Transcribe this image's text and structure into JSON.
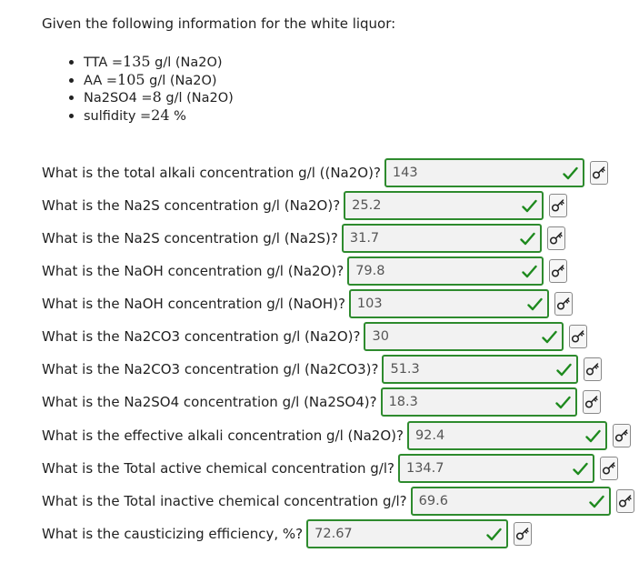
{
  "intro": "Given the following information for the white liquor:",
  "givens": [
    {
      "label": "TTA =",
      "value": "135",
      "unit": " g/l (Na2O)"
    },
    {
      "label": "AA =",
      "value": "105",
      "unit": " g/l (Na2O)"
    },
    {
      "label": "Na2SO4 =",
      "value": "8",
      "unit": " g/l (Na2O)"
    },
    {
      "label": "sulfidity =",
      "value": "24",
      "unit": " %"
    }
  ],
  "questions": [
    {
      "text": "What is the total alkali concentration g/l ((Na2O)?",
      "answer": "143"
    },
    {
      "text": "What is the Na2S concentration g/l (Na2O)?",
      "answer": "25.2"
    },
    {
      "text": "What is the Na2S concentration g/l (Na2S)?",
      "answer": "31.7"
    },
    {
      "text": "What is the NaOH concentration g/l (Na2O)?",
      "answer": "79.8"
    },
    {
      "text": "What is the NaOH concentration g/l (NaOH)?",
      "answer": "103"
    },
    {
      "text": "What is the Na2CO3 concentration g/l (Na2O)?",
      "answer": "30"
    },
    {
      "text": "What is the Na2CO3 concentration g/l (Na2CO3)?",
      "answer": "51.3"
    },
    {
      "text": "What is the Na2SO4 concentration g/l (Na2SO4)?",
      "answer": "18.3"
    },
    {
      "text": "What is the effective alkali concentration g/l (Na2O)?",
      "answer": "92.4"
    },
    {
      "text": "What is the Total active chemical concentration g/l?",
      "answer": "134.7"
    },
    {
      "text": "What is the Total inactive chemical concentration g/l?",
      "answer": "69.6"
    },
    {
      "text": "What is the causticizing efficiency, %?",
      "answer": "72.67"
    }
  ],
  "icons": {
    "correct": "check-icon",
    "key": "key-icon"
  },
  "colors": {
    "correct_border": "#2e8b2e",
    "check": "#1e8a1e",
    "field_bg": "#f2f2f2"
  }
}
